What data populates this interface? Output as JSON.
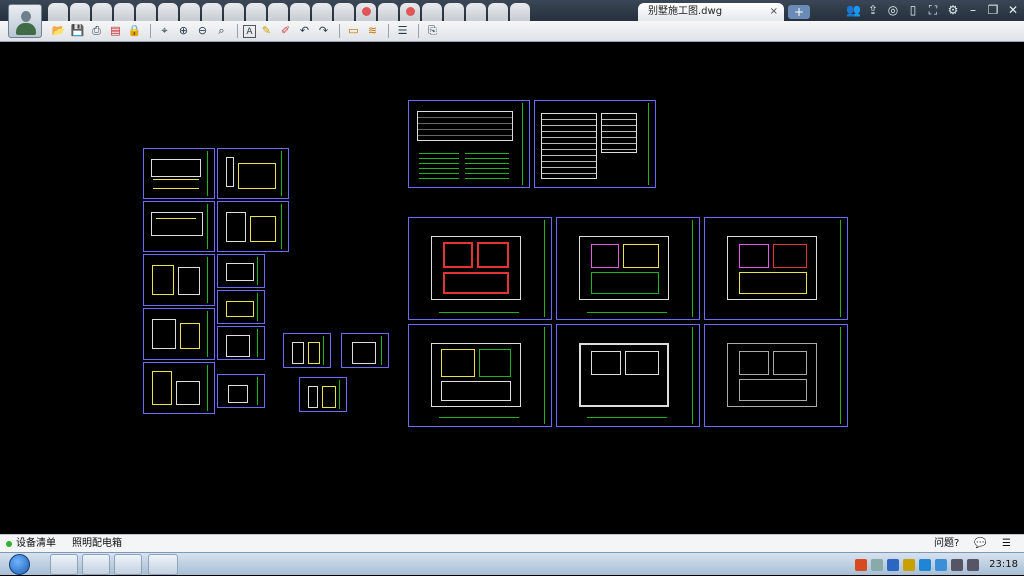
{
  "window": {
    "document_tab": "别墅施工图.dwg",
    "close_glyph": "×",
    "new_tab_glyph": "+",
    "tab_count": 22,
    "sys_icons": [
      "users-icon",
      "share-icon",
      "chat-icon",
      "phone-icon",
      "fullscreen-icon",
      "settings-icon",
      "minimize-icon",
      "restore-icon",
      "close-icon"
    ]
  },
  "toolbar": {
    "tools": [
      "open-icon",
      "save-icon",
      "print-icon",
      "pdf-icon",
      "lock-icon",
      "|",
      "measure-icon",
      "zoom-in-icon",
      "zoom-out-icon",
      "zoom-window-icon",
      "|",
      "text-icon",
      "pencil-icon",
      "marker-icon",
      "undo-icon",
      "redo-icon",
      "|",
      "ruler-icon",
      "dimension-icon",
      "|",
      "layers-icon",
      "|",
      "export-icon"
    ]
  },
  "status": {
    "item1": "设备清单",
    "item2": "照明配电箱",
    "help": "问题?",
    "chat_glyph": "💬",
    "list_glyph": "☰"
  },
  "taskbar": {
    "time": "23:18"
  },
  "colors": {
    "sheet_border": "#6b6bff",
    "strip": "#1db31d",
    "red": "#e23434",
    "yellow": "#e8e34a",
    "magenta": "#e05be0",
    "white": "#dddddd"
  }
}
